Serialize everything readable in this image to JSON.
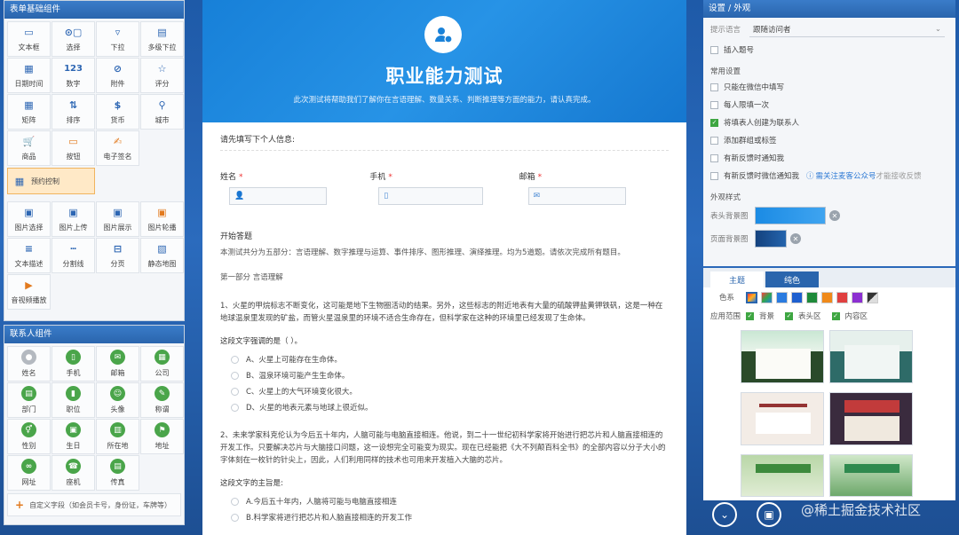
{
  "left": {
    "basic_title": "表单基础组件",
    "basic_items": [
      {
        "label": "文本框",
        "icon": "textbox-icon"
      },
      {
        "label": "选择",
        "icon": "select-icon"
      },
      {
        "label": "下拉",
        "icon": "dropdown-icon"
      },
      {
        "label": "多级下拉",
        "icon": "multi-dropdown-icon"
      },
      {
        "label": "日期时间",
        "icon": "calendar-icon"
      },
      {
        "label": "数字",
        "icon": "number-icon"
      },
      {
        "label": "附件",
        "icon": "attachment-icon"
      },
      {
        "label": "评分",
        "icon": "star-icon"
      },
      {
        "label": "矩阵",
        "icon": "matrix-icon"
      },
      {
        "label": "排序",
        "icon": "sort-icon"
      },
      {
        "label": "货币",
        "icon": "currency-icon"
      },
      {
        "label": "城市",
        "icon": "location-icon"
      },
      {
        "label": "商品",
        "icon": "cart-icon"
      },
      {
        "label": "按钮",
        "icon": "button-icon"
      },
      {
        "label": "电子签名",
        "icon": "signature-icon"
      }
    ],
    "reserve_label": "预约控制",
    "media_items": [
      {
        "label": "图片选择",
        "icon": "image-select-icon"
      },
      {
        "label": "图片上传",
        "icon": "image-upload-icon"
      },
      {
        "label": "图片展示",
        "icon": "image-display-icon"
      },
      {
        "label": "图片轮播",
        "icon": "carousel-icon"
      },
      {
        "label": "文本描述",
        "icon": "text-desc-icon"
      },
      {
        "label": "分割线",
        "icon": "divider-icon"
      },
      {
        "label": "分页",
        "icon": "pagination-icon"
      },
      {
        "label": "静态地图",
        "icon": "map-icon"
      },
      {
        "label": "音视频播放",
        "icon": "media-play-icon"
      }
    ],
    "contact_title": "联系人组件",
    "contact_items": [
      {
        "label": "姓名",
        "icon": "user-icon",
        "glyph": "●",
        "style": "gray"
      },
      {
        "label": "手机",
        "icon": "phone-icon",
        "glyph": "▯",
        "style": "green"
      },
      {
        "label": "邮箱",
        "icon": "mail-icon",
        "glyph": "✉",
        "style": "green"
      },
      {
        "label": "公司",
        "icon": "company-icon",
        "glyph": "▦",
        "style": "green"
      },
      {
        "label": "部门",
        "icon": "department-icon",
        "glyph": "▤",
        "style": "green"
      },
      {
        "label": "职位",
        "icon": "position-icon",
        "glyph": "▮",
        "style": "green"
      },
      {
        "label": "头像",
        "icon": "avatar-icon",
        "glyph": "☺",
        "style": "green"
      },
      {
        "label": "称谓",
        "icon": "title-icon",
        "glyph": "✎",
        "style": "green"
      },
      {
        "label": "性别",
        "icon": "gender-icon",
        "glyph": "⚥",
        "style": "green"
      },
      {
        "label": "生日",
        "icon": "birthday-icon",
        "glyph": "▣",
        "style": "green"
      },
      {
        "label": "所在地",
        "icon": "region-icon",
        "glyph": "▥",
        "style": "green"
      },
      {
        "label": "地址",
        "icon": "address-icon",
        "glyph": "⚑",
        "style": "green"
      },
      {
        "label": "网址",
        "icon": "link-icon",
        "glyph": "∞",
        "style": "green"
      },
      {
        "label": "座机",
        "icon": "telephone-icon",
        "glyph": "☎",
        "style": "green"
      },
      {
        "label": "传真",
        "icon": "fax-icon",
        "glyph": "▤",
        "style": "green"
      }
    ],
    "custom_field": "自定义字段（如会员卡号，身份证，车牌等）"
  },
  "form": {
    "title": "职业能力测试",
    "subtitle": "此次测试将帮助我们了解你在言语理解、数量关系、判断推理等方面的能力，请认真完成。",
    "info_title": "请先填写下个人信息:",
    "fields": [
      {
        "label": "姓名",
        "icon": "user-icon",
        "glyph": "👤"
      },
      {
        "label": "手机",
        "icon": "phone-icon",
        "glyph": "▯"
      },
      {
        "label": "邮箱",
        "icon": "mail-icon",
        "glyph": "✉"
      }
    ],
    "required_mark": "*",
    "start_title": "开始答题",
    "intro": "本测试共分为五部分：言语理解、数字推理与运算、事件排序、图形推理、演绎推理。均为5道题。请依次完成所有题目。",
    "part1": "第一部分 言语理解",
    "q1": "1、火星的甲烷标志不断变化，这可能是地下生物圈活动的结果。另外，这些标志的附近地表有大量的硫酸钾盐黄钾铁矾，这是一种在地球温泉里发现的矿盐，而管火星温泉里的环境不适合生命存在，但科学家在这种的环境里已经发现了生命体。",
    "q1_sub": "这段文字强调的是（ ）。",
    "q1_opts": [
      "A、火星上可能存在生命体。",
      "B、温泉环境可能产生生命体。",
      "C、火星上的大气环境变化很大。",
      "D、火星的地表元素与地球上很近似。"
    ],
    "q2": "2、未来学家科克伦认为今后五十年内，人脑可能与电脑直接相连。他说，到二十一世纪初科学家将开始进行把芯片和人脑直接相连的开发工作。只要解决芯片与大脑接口问题，这一设想完全可能变为现实。现在已经能把《大不列颠百科全书》的全部内容以分子大小的字体刻在一枚针的针尖上，因此，人们利用同样的技术也可用来开发植入大脑的芯片。",
    "q2_sub": "这段文字的主旨是:",
    "q2_opts": [
      "A.今后五十年内，人脑将可能与电脑直接相连",
      "B.科学家将进行把芯片和人脑直接相连的开发工作"
    ]
  },
  "right": {
    "title": "设置 / 外观",
    "lang_label": "提示语言",
    "lang_value": "跟随访问者",
    "insert_no": "插入题号",
    "common_title": "常用设置",
    "options": [
      {
        "label": "只能在微信中填写",
        "checked": false
      },
      {
        "label": "每人限填一次",
        "checked": false
      },
      {
        "label": "将填表人创建为联系人",
        "checked": true
      },
      {
        "label": "添加群组或标签",
        "checked": false
      },
      {
        "label": "有新反馈时通知我",
        "checked": false
      }
    ],
    "wechat_notify": "有新反馈时微信通知我",
    "wechat_link": "需关注麦客公众号",
    "wechat_link_tail": "才能接收反馈",
    "appearance_title": "外观样式",
    "header_bg": "表头背景图",
    "page_bg": "页面背景图",
    "tab_theme": "主题",
    "tab_color": "纯色",
    "color_label": "色系",
    "scope_label": "应用范围",
    "scope_items": [
      "背景",
      "表头区",
      "内容区"
    ],
    "chips": [
      "#ff3b3b",
      "#ffb020",
      "#2a7be0",
      "#1e5fcf",
      "#2fa84f",
      "#1f8a3a",
      "#f08a1a",
      "#e04040",
      "#8c2fd1",
      "#333333"
    ],
    "watermark": "@稀土掘金技术社区"
  }
}
